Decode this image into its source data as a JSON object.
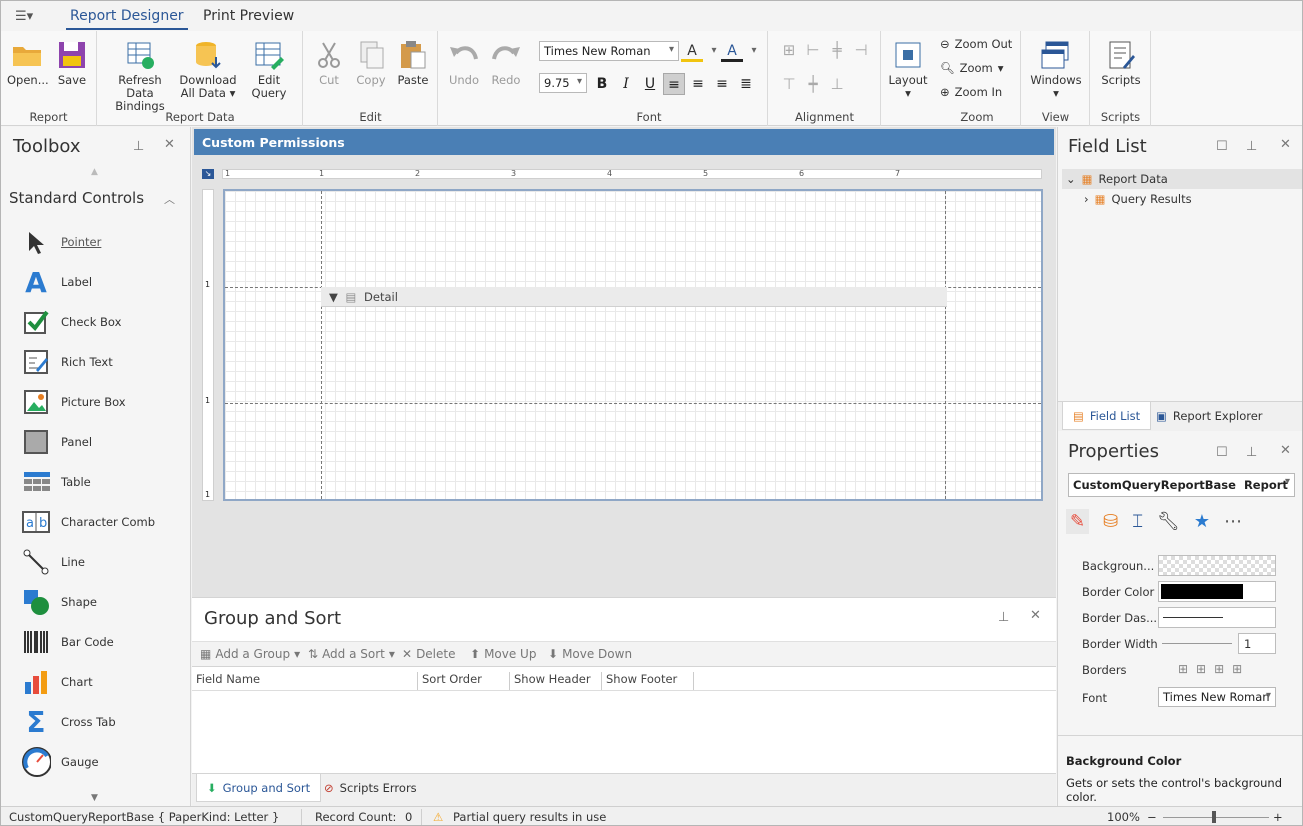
{
  "tabs": [
    "Report Designer",
    "Print Preview"
  ],
  "ribbon": {
    "groups": {
      "report": "Report",
      "report_data": "Report Data",
      "edit": "Edit",
      "font": "Font",
      "alignment": "Alignment",
      "zoom": "Zoom",
      "view": "View",
      "scripts": "Scripts"
    },
    "open": "Open...",
    "save": "Save",
    "refresh_l1": "Refresh Data",
    "refresh_l2": "Bindings",
    "download_l1": "Download",
    "download_l2": "All Data",
    "edit_query": "Edit Query",
    "cut": "Cut",
    "copy": "Copy",
    "paste": "Paste",
    "undo": "Undo",
    "redo": "Redo",
    "font_name": "Times New Roman",
    "font_size": "9.75",
    "layout": "Layout",
    "zoom_out": "Zoom Out",
    "zoom": "Zoom",
    "zoom_in": "Zoom In",
    "windows": "Windows",
    "scripts": "Scripts"
  },
  "toolbox": {
    "title": "Toolbox",
    "section": "Standard Controls",
    "items": [
      "Pointer",
      "Label",
      "Check Box",
      "Rich Text",
      "Picture Box",
      "Panel",
      "Table",
      "Character Comb",
      "Line",
      "Shape",
      "Bar Code",
      "Chart",
      "Cross Tab",
      "Gauge"
    ]
  },
  "report": {
    "title": "Custom Permissions",
    "detail": "Detail",
    "ruler_marks": [
      "1",
      "1",
      "2",
      "3",
      "4",
      "5",
      "6",
      "7"
    ],
    "vruler_marks": [
      "1",
      "1",
      "1"
    ]
  },
  "group_sort": {
    "title": "Group and Sort",
    "toolbar": [
      "Add a Group",
      "Add a Sort",
      "Delete",
      "Move Up",
      "Move Down"
    ],
    "columns": [
      "Field Name",
      "Sort Order",
      "Show Header",
      "Show Footer"
    ],
    "tabs": [
      "Group and Sort",
      "Scripts Errors"
    ]
  },
  "field_list": {
    "title": "Field List",
    "tree": [
      "Report Data",
      "Query Results"
    ],
    "tabs": [
      "Field List",
      "Report Explorer"
    ]
  },
  "properties": {
    "title": "Properties",
    "selector": "CustomQueryReportBase",
    "selector_type": "Report",
    "rows": [
      "Backgroun...",
      "Border Color",
      "Border Das...",
      "Border Width",
      "Borders",
      "Font"
    ],
    "border_width": "1",
    "font": "Times New Roman",
    "desc_title": "Background Color",
    "desc_text": "Gets or sets the control's background color."
  },
  "status": {
    "report": "CustomQueryReportBase { PaperKind: Letter }",
    "record_label": "Record Count:",
    "record_count": "0",
    "warning": "Partial query results in use",
    "zoom": "100%"
  },
  "colors": {
    "accent": "#2b5797",
    "report_header": "#4a7fb5",
    "warning": "#f5a623"
  }
}
